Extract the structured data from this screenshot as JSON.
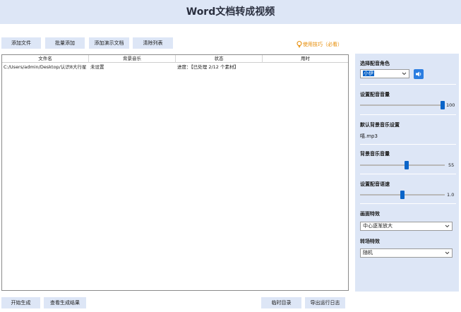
{
  "header": {
    "title": "Word文档转成视频"
  },
  "toolbar": {
    "add_file": "添加文件",
    "batch_add": "批量添加",
    "add_ppt": "添加演示文档",
    "clear_list": "清除列表",
    "tips": "使用技巧（必看）"
  },
  "table": {
    "columns": [
      "文件名",
      "背景音乐",
      "状态",
      "用时"
    ],
    "rows": [
      {
        "file": "C:/Users/admin/Desktop/认识8大行星",
        "music": "未设置",
        "status": "进度：【已处理 2/12 个素材】",
        "time": ""
      }
    ]
  },
  "panel": {
    "voice_role_label": "选择配音角色",
    "voice_role_value": "小伊",
    "voice_volume_label": "设置配音音量",
    "voice_volume_value": "100",
    "voice_volume_level": 100,
    "default_bgm_label": "默认背景音乐设置",
    "default_bgm_value": "嘻.mp3",
    "bgm_volume_label": "背景音乐音量",
    "bgm_volume_value": "55",
    "bgm_volume_level": 55,
    "voice_speed_label": "设置配音语速",
    "voice_speed_value": "1.0",
    "voice_speed_level": 0.5,
    "effect_label": "画面特效",
    "effect_value": "中心逐渐放大",
    "transition_label": "转场特效",
    "transition_value": "随机"
  },
  "footer": {
    "start": "开始生成",
    "view_result": "查看生成结果",
    "temp_dir": "临时目录",
    "export_log": "导出运行日志"
  },
  "colors": {
    "accent": "#0a64c8",
    "panel_bg": "#dde6f6",
    "tips": "#e68a00"
  }
}
